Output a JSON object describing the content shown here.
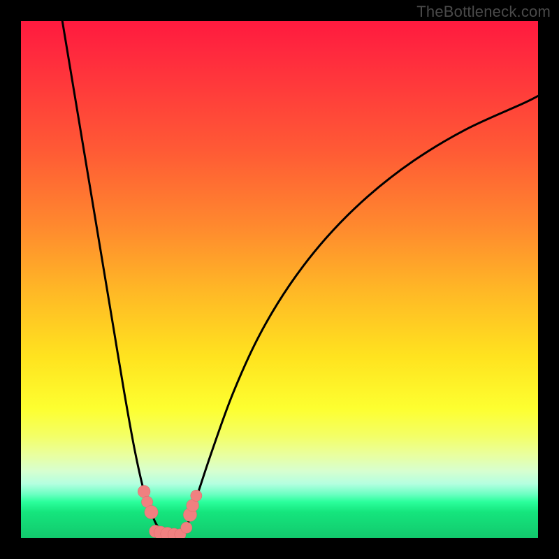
{
  "watermark": "TheBottleneck.com",
  "colors": {
    "frame": "#000000",
    "curve_stroke": "#000000",
    "marker_fill": "#f08080",
    "marker_stroke": "#d86a6a"
  },
  "chart_data": {
    "type": "line",
    "title": "",
    "xlabel": "",
    "ylabel": "",
    "xlim": [
      0,
      100
    ],
    "ylim": [
      0,
      100
    ],
    "grid": false,
    "series": [
      {
        "name": "left-branch",
        "x": [
          8,
          10,
          12,
          14,
          16,
          18,
          20,
          22,
          23.8,
          25.2,
          26,
          27,
          28
        ],
        "y": [
          100,
          88,
          76,
          64,
          52,
          40,
          28,
          17,
          9,
          5,
          3,
          1.5,
          0.5
        ]
      },
      {
        "name": "right-branch",
        "x": [
          31,
          32,
          34,
          37,
          41,
          46,
          52,
          59,
          67,
          76,
          86,
          97,
          100
        ],
        "y": [
          0.5,
          2,
          8,
          17,
          28,
          39,
          49,
          58,
          66,
          73,
          79,
          84,
          85.5
        ]
      }
    ],
    "markers": [
      {
        "x": 23.8,
        "y": 9.0,
        "r": 1.2
      },
      {
        "x": 24.4,
        "y": 7.0,
        "r": 1.1
      },
      {
        "x": 25.2,
        "y": 5.0,
        "r": 1.3
      },
      {
        "x": 26.0,
        "y": 1.3,
        "r": 1.2
      },
      {
        "x": 27.0,
        "y": 1.0,
        "r": 1.3
      },
      {
        "x": 28.3,
        "y": 0.8,
        "r": 1.3
      },
      {
        "x": 29.6,
        "y": 0.7,
        "r": 1.2
      },
      {
        "x": 30.8,
        "y": 0.7,
        "r": 1.1
      },
      {
        "x": 32.0,
        "y": 2.0,
        "r": 1.1
      },
      {
        "x": 32.7,
        "y": 4.5,
        "r": 1.3
      },
      {
        "x": 33.2,
        "y": 6.3,
        "r": 1.2
      },
      {
        "x": 33.9,
        "y": 8.2,
        "r": 1.1
      }
    ]
  }
}
